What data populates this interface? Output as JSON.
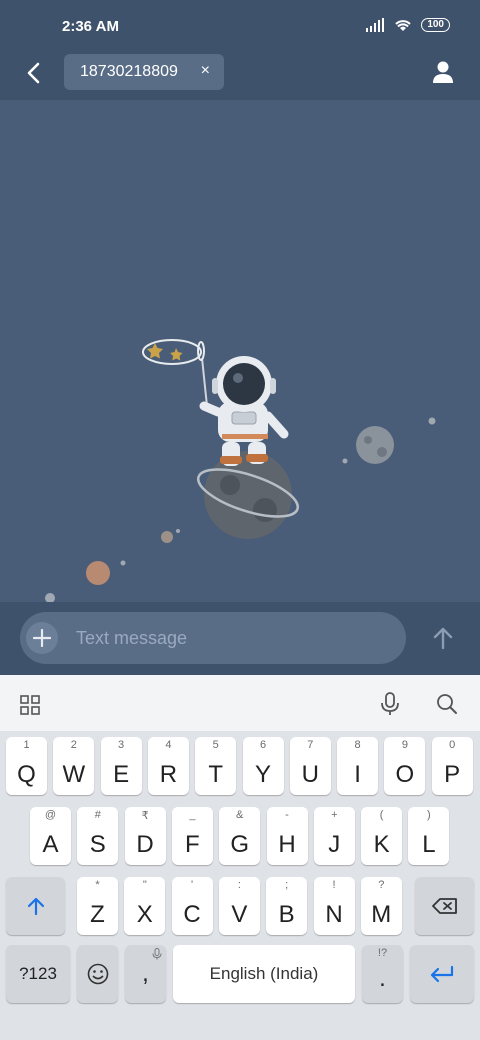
{
  "status_bar": {
    "time": "2:36 AM",
    "battery": "100"
  },
  "header": {
    "recipient": "18730218809",
    "remove_symbol": "×"
  },
  "composer": {
    "placeholder": "Text message"
  },
  "keyboard": {
    "row1": [
      {
        "main": "Q",
        "sub": "1"
      },
      {
        "main": "W",
        "sub": "2"
      },
      {
        "main": "E",
        "sub": "3"
      },
      {
        "main": "R",
        "sub": "4"
      },
      {
        "main": "T",
        "sub": "5"
      },
      {
        "main": "Y",
        "sub": "6"
      },
      {
        "main": "U",
        "sub": "7"
      },
      {
        "main": "I",
        "sub": "8"
      },
      {
        "main": "O",
        "sub": "9"
      },
      {
        "main": "P",
        "sub": "0"
      }
    ],
    "row2": [
      {
        "main": "A",
        "sub": "@"
      },
      {
        "main": "S",
        "sub": "#"
      },
      {
        "main": "D",
        "sub": "₹"
      },
      {
        "main": "F",
        "sub": "_"
      },
      {
        "main": "G",
        "sub": "&"
      },
      {
        "main": "H",
        "sub": "-"
      },
      {
        "main": "J",
        "sub": "+"
      },
      {
        "main": "K",
        "sub": "("
      },
      {
        "main": "L",
        "sub": ")"
      }
    ],
    "row3": [
      {
        "main": "Z",
        "sub": "*"
      },
      {
        "main": "X",
        "sub": "\""
      },
      {
        "main": "C",
        "sub": "'"
      },
      {
        "main": "V",
        "sub": ":"
      },
      {
        "main": "B",
        "sub": ";"
      },
      {
        "main": "N",
        "sub": "!"
      },
      {
        "main": "M",
        "sub": "?"
      }
    ],
    "symbols_label": "?123",
    "comma": ",",
    "period": ".",
    "period_sub": "!?",
    "space_label": "English (India)"
  },
  "colors": {
    "accent": "#1a73e8",
    "background": "#4a5d78",
    "bar": "#3f526b"
  }
}
